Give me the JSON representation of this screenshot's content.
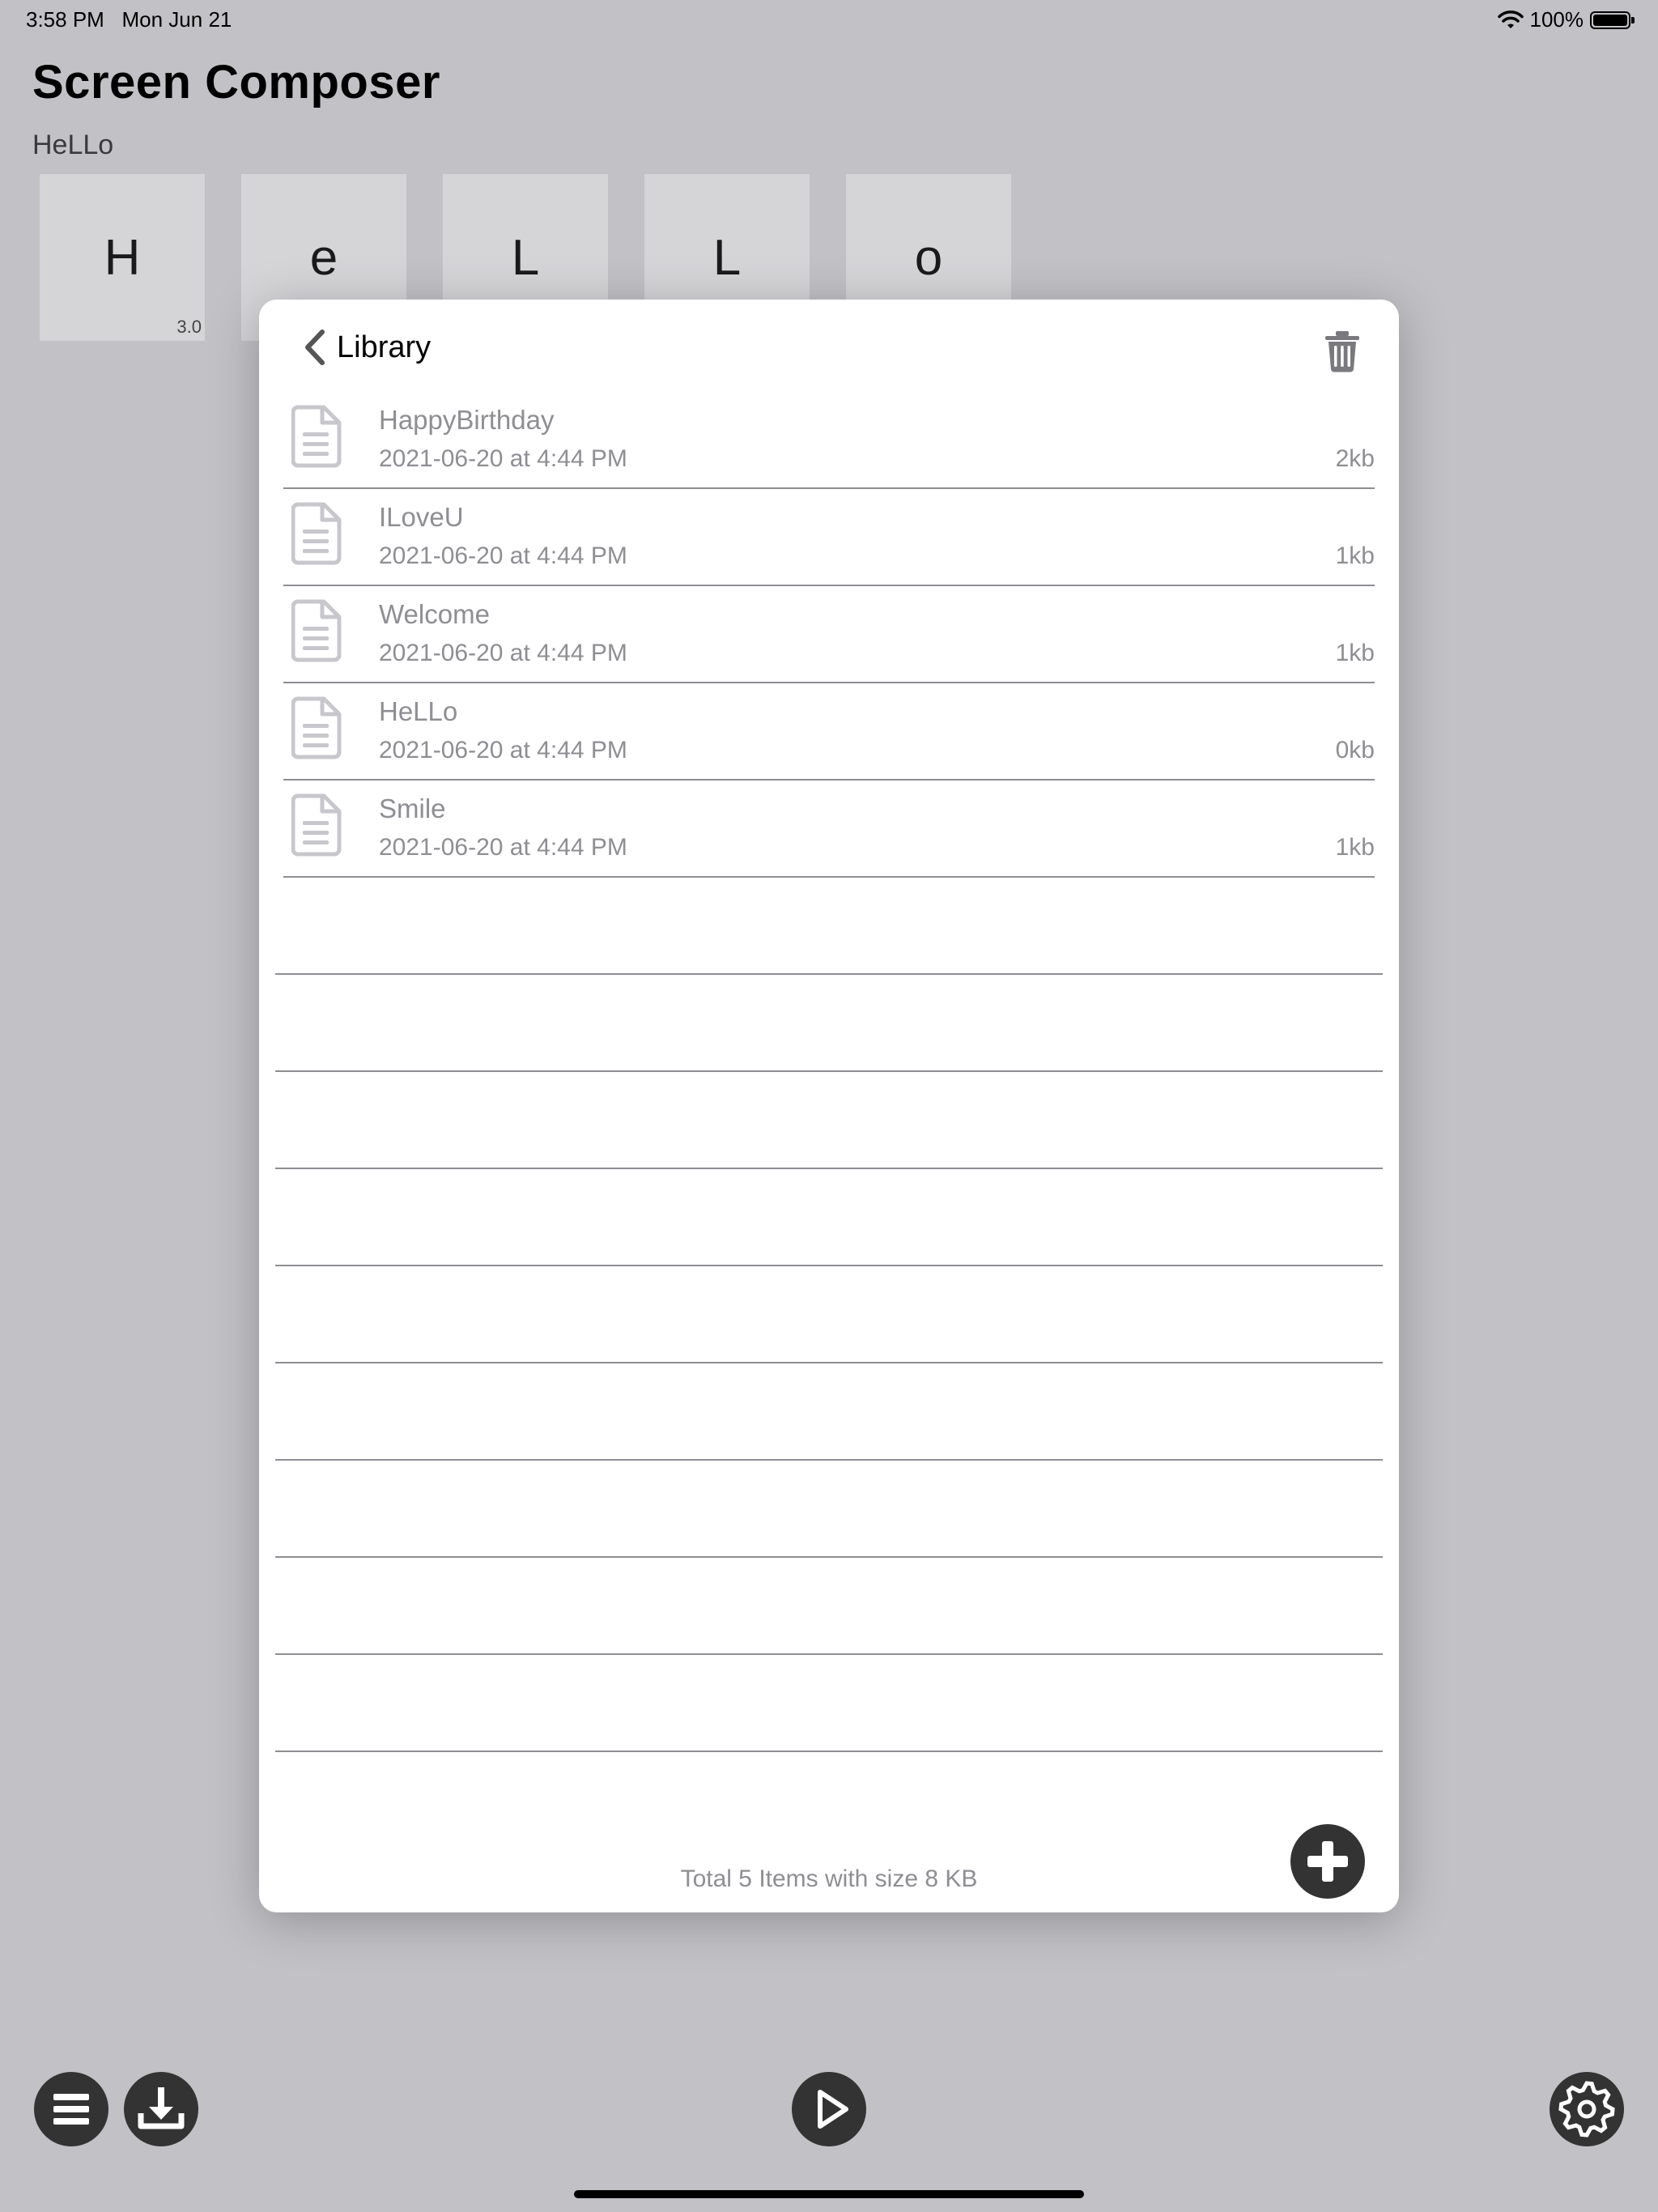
{
  "status_bar": {
    "time": "3:58 PM",
    "date": "Mon Jun 21",
    "battery": "100%",
    "battery_level": 1.0
  },
  "app": {
    "title": "Screen Composer",
    "subtitle": "HeLLo"
  },
  "tiles": [
    {
      "letter": "H",
      "badge": "3.0"
    },
    {
      "letter": "e",
      "badge": ""
    },
    {
      "letter": "L",
      "badge": ""
    },
    {
      "letter": "L",
      "badge": ""
    },
    {
      "letter": "o",
      "badge": ""
    }
  ],
  "library": {
    "back_label": "Library",
    "files": [
      {
        "name": "HappyBirthday",
        "date": "2021-06-20 at 4:44 PM",
        "size": "2kb"
      },
      {
        "name": "ILoveU",
        "date": "2021-06-20 at 4:44 PM",
        "size": "1kb"
      },
      {
        "name": "Welcome",
        "date": "2021-06-20 at 4:44 PM",
        "size": "1kb"
      },
      {
        "name": "HeLLo",
        "date": "2021-06-20 at 4:44 PM",
        "size": "0kb"
      },
      {
        "name": "Smile",
        "date": "2021-06-20 at 4:44 PM",
        "size": "1kb"
      }
    ],
    "footer": "Total 5 Items with size 8 KB"
  },
  "toolbar": {
    "icons": [
      "menu-icon",
      "download-icon",
      "play-icon",
      "settings-icon"
    ]
  },
  "colors": {
    "background": "#c2c2c6",
    "modal": "#ffffff",
    "text_secondary": "#8e8e93",
    "button_dark": "#333333"
  }
}
